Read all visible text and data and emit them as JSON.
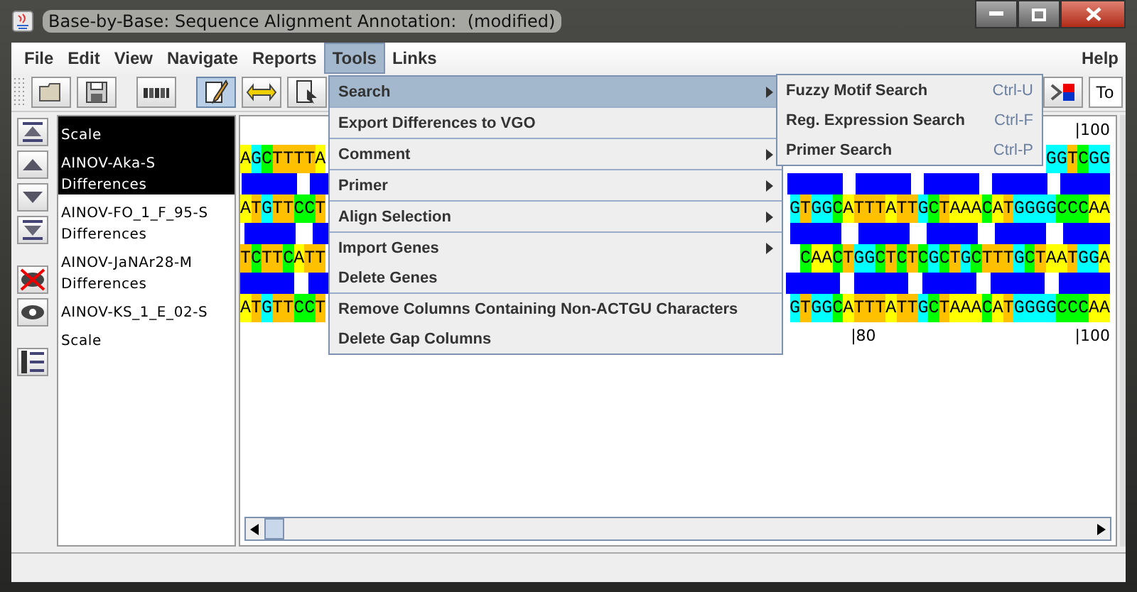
{
  "window": {
    "title": "Base-by-Base: Sequence Alignment Annotation:  (modified)"
  },
  "menu_bar": {
    "items": [
      {
        "label": "File",
        "selected": false
      },
      {
        "label": "Edit",
        "selected": false
      },
      {
        "label": "View",
        "selected": false
      },
      {
        "label": "Navigate",
        "selected": false
      },
      {
        "label": "Reports",
        "selected": false
      },
      {
        "label": "Tools",
        "selected": true
      },
      {
        "label": "Links",
        "selected": false
      }
    ],
    "help": "Help"
  },
  "toolbar": {
    "edit_mode_on": true,
    "field": "To"
  },
  "rows": [
    {
      "kind": "scale",
      "name": "Scale",
      "selected": true,
      "ticks": [
        "|100"
      ]
    },
    {
      "kind": "sequence",
      "name": "AINOV-Aka-S",
      "selected": true,
      "left": "AGCTTTTA",
      "right": "GGTCGG"
    },
    {
      "kind": "differences",
      "name": "Differences",
      "selected": true
    },
    {
      "kind": "sequence",
      "name": "AINOV-FO_1_F_95-S",
      "selected": false,
      "left": "ATGTTCCT",
      "right": "GTGGCATTTATTGCTAAACATGGGGCCCAA"
    },
    {
      "kind": "differences",
      "name": "Differences",
      "selected": false
    },
    {
      "kind": "sequence",
      "name": "AINOV-JaNAr28-M",
      "selected": false,
      "left": "TCTTCATT",
      "right": "CAACTGGCTCTCGCTGCTTTGCTAATGGA"
    },
    {
      "kind": "differences",
      "name": "Differences",
      "selected": false
    },
    {
      "kind": "sequence",
      "name": "AINOV-KS_1_E_02-S",
      "selected": false,
      "left": "ATGTTCCT",
      "right": "GTGGCATTTATTGCTAAACATGGGGCCCAA"
    },
    {
      "kind": "scale",
      "name": "Scale",
      "selected": false,
      "ticks": [
        "|80",
        "|100"
      ]
    }
  ],
  "tools_menu": {
    "groups": [
      [
        {
          "label": "Search",
          "selected": true,
          "submenu": true
        }
      ],
      [
        {
          "label": "Export Differences to VGO",
          "selected": false,
          "submenu": false
        }
      ],
      [
        {
          "label": "Comment",
          "selected": false,
          "submenu": true
        }
      ],
      [
        {
          "label": "Primer",
          "selected": false,
          "submenu": true
        }
      ],
      [
        {
          "label": "Align Selection",
          "selected": false,
          "submenu": true
        }
      ],
      [
        {
          "label": "Import Genes",
          "selected": false,
          "submenu": true
        },
        {
          "label": "Delete Genes",
          "selected": false,
          "submenu": false
        }
      ],
      [
        {
          "label": "Remove Columns Containing Non-ACTGU Characters",
          "selected": false,
          "submenu": false
        },
        {
          "label": "Delete Gap Columns",
          "selected": false,
          "submenu": false
        }
      ]
    ]
  },
  "search_submenu": {
    "items": [
      {
        "label": "Fuzzy Motif Search",
        "shortcut": "Ctrl-U"
      },
      {
        "label": "Reg. Expression Search",
        "shortcut": "Ctrl-F"
      },
      {
        "label": "Primer Search",
        "shortcut": "Ctrl-P"
      }
    ]
  }
}
